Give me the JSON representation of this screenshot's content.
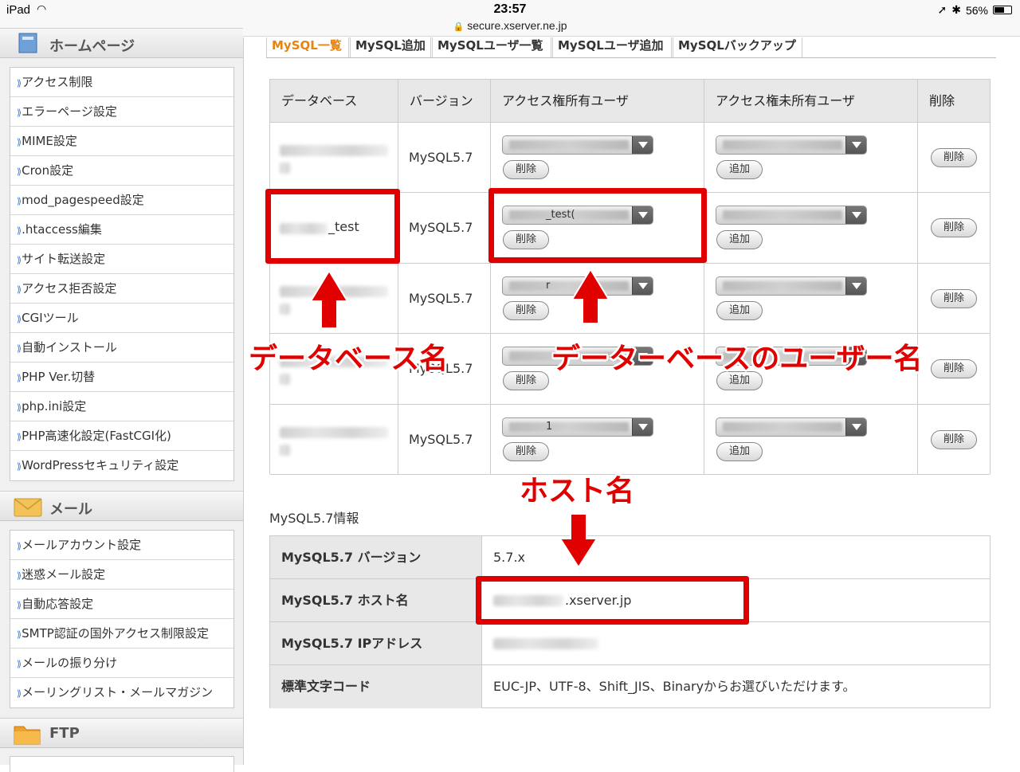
{
  "statusbar": {
    "device": "iPad",
    "time": "23:57",
    "url": "secure.xserver.ne.jp",
    "battery": "56%"
  },
  "sidebar": {
    "homepage": {
      "title": "ホームページ",
      "items": [
        "アクセス制限",
        "エラーページ設定",
        "MIME設定",
        "Cron設定",
        "mod_pagespeed設定",
        ".htaccess編集",
        "サイト転送設定",
        "アクセス拒否設定",
        "CGIツール",
        "自動インストール",
        "PHP Ver.切替",
        "php.ini設定",
        "PHP高速化設定(FastCGI化)",
        "WordPressセキュリティ設定"
      ]
    },
    "mail": {
      "title": "メール",
      "items": [
        "メールアカウント設定",
        "迷惑メール設定",
        "自動応答設定",
        "SMTP認証の国外アクセス制限設定",
        "メールの振り分け",
        "メーリングリスト・メールマガジン"
      ]
    },
    "ftp": {
      "title": "FTP"
    }
  },
  "tabs": [
    "MySQL一覧",
    "MySQL追加",
    "MySQLユーザ一覧",
    "MySQLユーザ追加",
    "MySQLバックアップ"
  ],
  "db_table": {
    "headers": [
      "データベース",
      "バージョン",
      "アクセス権所有ユーザ",
      "アクセス権未所有ユーザ",
      "削除"
    ],
    "rows": [
      {
        "db_suffix": "",
        "version": "MySQL5.7",
        "owner_select": "",
        "owner_btn": "削除",
        "nonowner_btn": "追加",
        "delete": "削除"
      },
      {
        "db_suffix": "_test",
        "version": "MySQL5.7",
        "owner_select": "_test(",
        "owner_btn": "削除",
        "nonowner_btn": "追加",
        "delete": "削除"
      },
      {
        "db_suffix": "",
        "version": "MySQL5.7",
        "owner_select": "r",
        "owner_btn": "削除",
        "nonowner_btn": "追加",
        "delete": "削除"
      },
      {
        "db_suffix": "",
        "version": "MySQL5.7",
        "owner_select": "",
        "owner_btn": "削除",
        "nonowner_btn": "追加",
        "delete": "削除"
      },
      {
        "db_suffix": "",
        "version": "MySQL5.7",
        "owner_select": "1",
        "owner_btn": "削除",
        "nonowner_btn": "追加",
        "delete": "削除"
      }
    ]
  },
  "info": {
    "title": "MySQL5.7情報",
    "rows": [
      {
        "label": "MySQL5.7 バージョン",
        "value": "5.7.x"
      },
      {
        "label": "MySQL5.7 ホスト名",
        "value": ".xserver.jp"
      },
      {
        "label": "MySQL5.7 IPアドレス",
        "value": ""
      },
      {
        "label": "標準文字コード",
        "value": "EUC-JP、UTF-8、Shift_JIS、Binaryからお選びいただけます。"
      }
    ]
  },
  "annotations": {
    "db_name": "データベース名",
    "db_user": "データーベースのユーザー名",
    "host": "ホスト名"
  },
  "colors": {
    "annotation": "#e00000",
    "active_tab": "#e8830c"
  }
}
